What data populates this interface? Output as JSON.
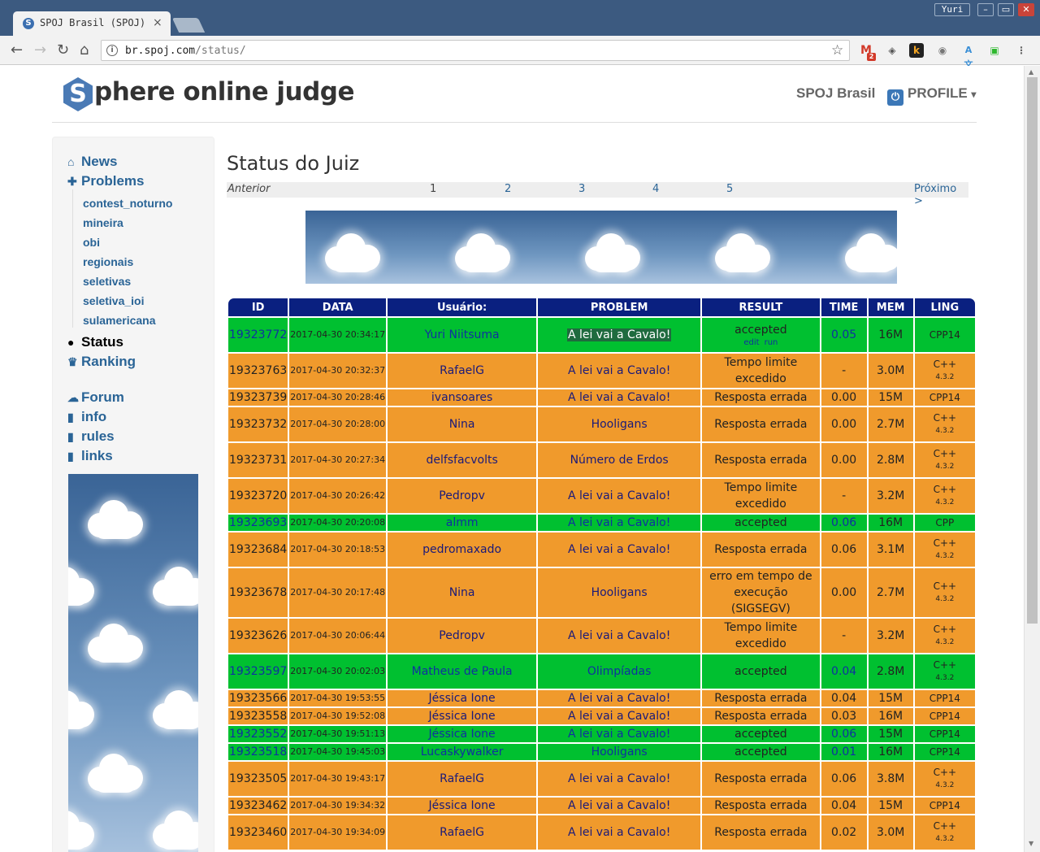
{
  "browser": {
    "tab_title": "SPOJ Brasil (SPOJ)",
    "tab_close": "×",
    "url_host": "br.spoj.com",
    "url_path": "/status/",
    "user_badge": "Yuri",
    "nav": {
      "back": "←",
      "forward": "→",
      "reload": "↻",
      "home": "⌂"
    },
    "extensions": [
      "gmail-icon",
      "shield-icon",
      "k-icon",
      "camera-icon",
      "translate-icon",
      "tv-icon",
      "menu-icon"
    ],
    "gmail_badge": "2"
  },
  "header": {
    "logo_letter": "S",
    "logo_text": "phere online judge",
    "site_name": "SPOJ Brasil",
    "profile_label": "PROFILE",
    "profile_caret": "▾"
  },
  "sidebar": {
    "items": [
      {
        "label": "News",
        "icon": "home-icon"
      },
      {
        "label": "Problems",
        "icon": "puzzle-icon"
      },
      {
        "label": "Status",
        "icon": "circle-icon"
      },
      {
        "label": "Ranking",
        "icon": "trophy-icon"
      },
      {
        "label": "Forum",
        "icon": "comments-icon"
      },
      {
        "label": "info",
        "icon": "file-icon"
      },
      {
        "label": "rules",
        "icon": "file-icon"
      },
      {
        "label": "links",
        "icon": "file-icon"
      }
    ],
    "subitems": [
      "contest_noturno",
      "mineira",
      "obi",
      "regionais",
      "seletivas",
      "seletiva_ioi",
      "sulamericana"
    ]
  },
  "content": {
    "title": "Status do Juiz",
    "pager": {
      "prev": "Anterior",
      "pages": [
        "1",
        "2",
        "3",
        "4",
        "5"
      ],
      "next": "Próximo >"
    },
    "table": {
      "headers": [
        "ID",
        "DATA",
        "Usuário:",
        "PROBLEM",
        "RESULT",
        "TIME",
        "MEM",
        "LING"
      ],
      "row0_links": {
        "edit": "edit",
        "run": "run"
      },
      "rows": [
        {
          "id": "19323772",
          "date": "2017-04-30 20:34:17",
          "user": "Yuri Niitsuma",
          "problem": "A lei vai a Cavalo!",
          "result": "accepted",
          "time": "0.05",
          "mem": "16M",
          "lang": "CPP14",
          "lang_ver": "",
          "status": "ok"
        },
        {
          "id": "19323763",
          "date": "2017-04-30 20:32:37",
          "user": "RafaelG",
          "problem": "A lei vai a Cavalo!",
          "result": "Tempo limite excedido",
          "time": "-",
          "mem": "3.0M",
          "lang": "C++",
          "lang_ver": "4.3.2",
          "status": "bad"
        },
        {
          "id": "19323739",
          "date": "2017-04-30 20:28:46",
          "user": "ivansoares",
          "problem": "A lei vai a Cavalo!",
          "result": "Resposta errada",
          "time": "0.00",
          "mem": "15M",
          "lang": "CPP14",
          "lang_ver": "",
          "status": "bad"
        },
        {
          "id": "19323732",
          "date": "2017-04-30 20:28:00",
          "user": "Nina",
          "problem": "Hooligans",
          "result": "Resposta errada",
          "time": "0.00",
          "mem": "2.7M",
          "lang": "C++",
          "lang_ver": "4.3.2",
          "status": "bad"
        },
        {
          "id": "19323731",
          "date": "2017-04-30 20:27:34",
          "user": "delfsfacvolts",
          "problem": "Número de Erdos",
          "result": "Resposta errada",
          "time": "0.00",
          "mem": "2.8M",
          "lang": "C++",
          "lang_ver": "4.3.2",
          "status": "bad"
        },
        {
          "id": "19323720",
          "date": "2017-04-30 20:26:42",
          "user": "Pedropv",
          "problem": "A lei vai a Cavalo!",
          "result": "Tempo limite excedido",
          "time": "-",
          "mem": "3.2M",
          "lang": "C++",
          "lang_ver": "4.3.2",
          "status": "bad"
        },
        {
          "id": "19323693",
          "date": "2017-04-30 20:20:08",
          "user": "almm",
          "problem": "A lei vai a Cavalo!",
          "result": "accepted",
          "time": "0.06",
          "mem": "16M",
          "lang": "CPP",
          "lang_ver": "",
          "status": "ok"
        },
        {
          "id": "19323684",
          "date": "2017-04-30 20:18:53",
          "user": "pedromaxado",
          "problem": "A lei vai a Cavalo!",
          "result": "Resposta errada",
          "time": "0.06",
          "mem": "3.1M",
          "lang": "C++",
          "lang_ver": "4.3.2",
          "status": "bad"
        },
        {
          "id": "19323678",
          "date": "2017-04-30 20:17:48",
          "user": "Nina",
          "problem": "Hooligans",
          "result": "erro em tempo de execução (SIGSEGV)",
          "time": "0.00",
          "mem": "2.7M",
          "lang": "C++",
          "lang_ver": "4.3.2",
          "status": "bad"
        },
        {
          "id": "19323626",
          "date": "2017-04-30 20:06:44",
          "user": "Pedropv",
          "problem": "A lei vai a Cavalo!",
          "result": "Tempo limite excedido",
          "time": "-",
          "mem": "3.2M",
          "lang": "C++",
          "lang_ver": "4.3.2",
          "status": "bad"
        },
        {
          "id": "19323597",
          "date": "2017-04-30 20:02:03",
          "user": "Matheus de Paula",
          "problem": "Olimpíadas",
          "result": "accepted",
          "time": "0.04",
          "mem": "2.8M",
          "lang": "C++",
          "lang_ver": "4.3.2",
          "status": "ok"
        },
        {
          "id": "19323566",
          "date": "2017-04-30 19:53:55",
          "user": "Jéssica Ione",
          "problem": "A lei vai a Cavalo!",
          "result": "Resposta errada",
          "time": "0.04",
          "mem": "15M",
          "lang": "CPP14",
          "lang_ver": "",
          "status": "bad"
        },
        {
          "id": "19323558",
          "date": "2017-04-30 19:52:08",
          "user": "Jéssica Ione",
          "problem": "A lei vai a Cavalo!",
          "result": "Resposta errada",
          "time": "0.03",
          "mem": "16M",
          "lang": "CPP14",
          "lang_ver": "",
          "status": "bad"
        },
        {
          "id": "19323552",
          "date": "2017-04-30 19:51:13",
          "user": "Jéssica Ione",
          "problem": "A lei vai a Cavalo!",
          "result": "accepted",
          "time": "0.06",
          "mem": "15M",
          "lang": "CPP14",
          "lang_ver": "",
          "status": "ok"
        },
        {
          "id": "19323518",
          "date": "2017-04-30 19:45:03",
          "user": "Lucaskywalker",
          "problem": "Hooligans",
          "result": "accepted",
          "time": "0.01",
          "mem": "16M",
          "lang": "CPP14",
          "lang_ver": "",
          "status": "ok"
        },
        {
          "id": "19323505",
          "date": "2017-04-30 19:43:17",
          "user": "RafaelG",
          "problem": "A lei vai a Cavalo!",
          "result": "Resposta errada",
          "time": "0.06",
          "mem": "3.8M",
          "lang": "C++",
          "lang_ver": "4.3.2",
          "status": "bad"
        },
        {
          "id": "19323462",
          "date": "2017-04-30 19:34:32",
          "user": "Jéssica Ione",
          "problem": "A lei vai a Cavalo!",
          "result": "Resposta errada",
          "time": "0.04",
          "mem": "15M",
          "lang": "CPP14",
          "lang_ver": "",
          "status": "bad"
        },
        {
          "id": "19323460",
          "date": "2017-04-30 19:34:09",
          "user": "RafaelG",
          "problem": "A lei vai a Cavalo!",
          "result": "Resposta errada",
          "time": "0.02",
          "mem": "3.0M",
          "lang": "C++",
          "lang_ver": "4.3.2",
          "status": "bad"
        }
      ]
    }
  },
  "colors": {
    "accepted": "#00c030",
    "rejected": "#f09a2c",
    "header": "#0a2080",
    "link": "#2a6496"
  }
}
